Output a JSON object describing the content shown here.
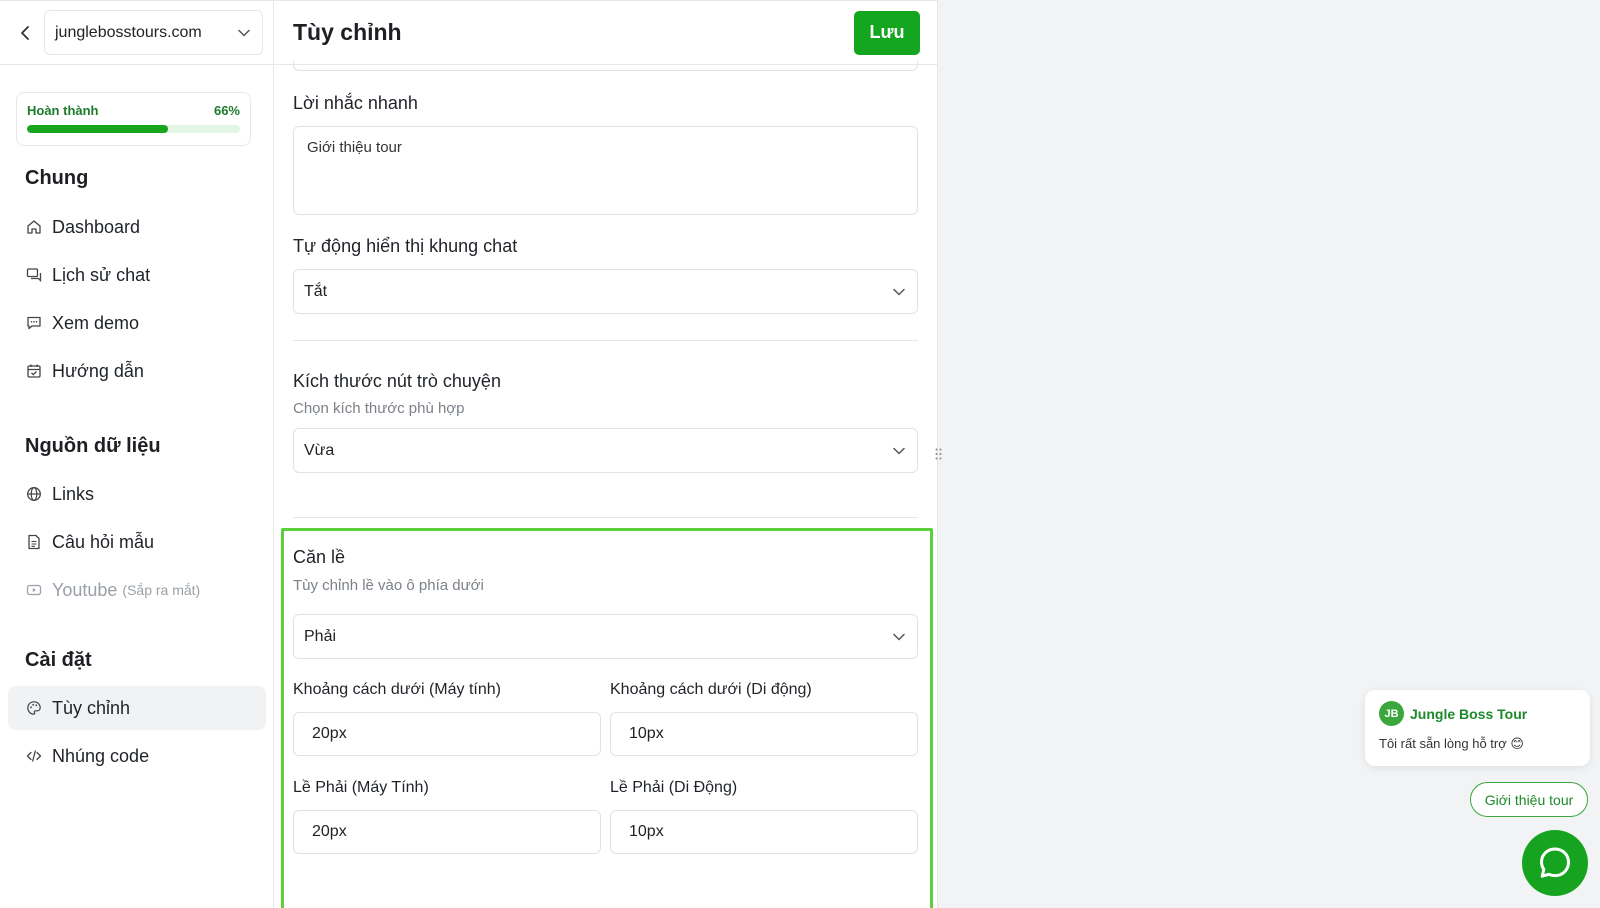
{
  "sidebar": {
    "site": "junglebosstours.com",
    "progress": {
      "label": "Hoàn thành",
      "value_text": "66%",
      "fraction": 0.66
    },
    "sections": [
      {
        "title": "Chung",
        "items": [
          {
            "label": "Dashboard",
            "icon": "home-icon"
          },
          {
            "label": "Lịch sử chat",
            "icon": "chat-history-icon"
          },
          {
            "label": "Xem demo",
            "icon": "message-icon"
          },
          {
            "label": "Hướng dẫn",
            "icon": "calendar-check-icon"
          }
        ]
      },
      {
        "title": "Nguồn dữ liệu",
        "items": [
          {
            "label": "Links",
            "icon": "globe-icon"
          },
          {
            "label": "Câu hỏi mẫu",
            "icon": "document-icon"
          },
          {
            "label": "Youtube",
            "soon": "(Sắp ra mắt)",
            "icon": "youtube-icon"
          }
        ]
      },
      {
        "title": "Cài đặt",
        "items": [
          {
            "label": "Tùy chỉnh",
            "icon": "palette-icon"
          },
          {
            "label": "Nhúng code",
            "icon": "code-icon"
          }
        ]
      }
    ]
  },
  "main": {
    "title": "Tùy chỉnh",
    "save_label": "Lưu",
    "quick_prompt": {
      "label": "Lời nhắc nhanh",
      "value": "Giới thiệu tour"
    },
    "auto_show": {
      "label": "Tự động hiển thị khung chat",
      "value": "Tắt"
    },
    "button_size": {
      "label": "Kích thước nút trò chuyện",
      "sub": "Chọn kích thước phù hợp",
      "value": "Vừa"
    },
    "alignment": {
      "label": "Căn lề",
      "sub": "Tùy chỉnh lề vào ô phía dưới",
      "value": "Phải",
      "bottom_desktop": {
        "label": "Khoảng cách dưới (Máy tính)",
        "value": "20px"
      },
      "bottom_mobile": {
        "label": "Khoảng cách dưới (Di động)",
        "value": "10px"
      },
      "right_desktop": {
        "label": "Lề Phải (Máy Tính)",
        "value": "20px"
      },
      "right_mobile": {
        "label": "Lề Phải (Di Động)",
        "value": "10px"
      }
    }
  },
  "preview": {
    "avatar_text": "JB",
    "bot_name": "Jungle Boss Tour",
    "greeting": "Tôi rất sẵn lòng hỗ trợ 😊",
    "quick_button": "Giới thiệu tour"
  },
  "colors": {
    "accent": "#15a620",
    "highlight": "#5cd03b"
  }
}
